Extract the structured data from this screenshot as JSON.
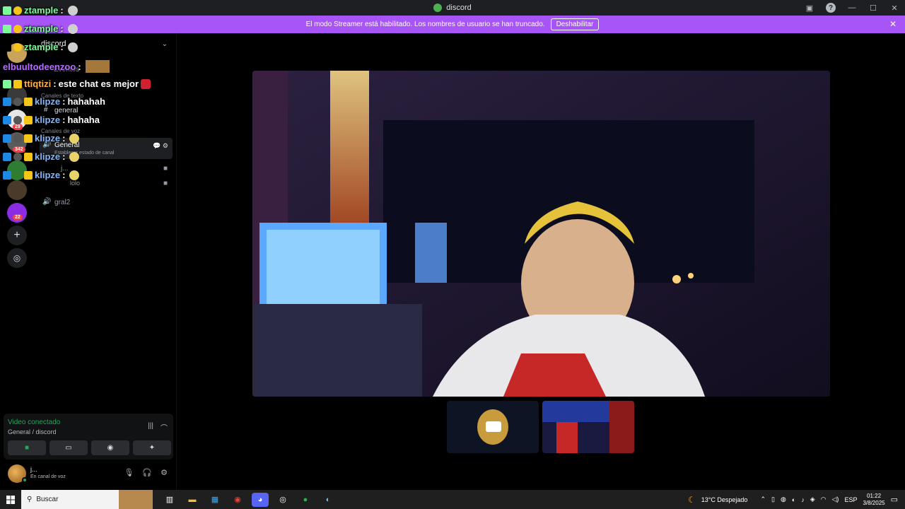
{
  "window": {
    "title": "discord",
    "help_icon": "?"
  },
  "banner": {
    "message": "El modo Streamer está habilitado. Los nombres de usuario se han truncado.",
    "button_label": "Deshabilitar"
  },
  "rail": {
    "badges": [
      "29",
      "342",
      "22"
    ]
  },
  "sidebar": {
    "server_name": "discord",
    "events_label": "Eventos",
    "text_category": "Canales de texto",
    "text_channel": "general",
    "voice_category": "Canales de voz",
    "voice_channel": "General",
    "channel_status_placeholder": "Establecer estado de canal",
    "voice_user_1": "j...",
    "voice_user_2": "lolo",
    "voice_channel_2": "gral2"
  },
  "voice_panel": {
    "status": "Video conectado",
    "location": "General / discord"
  },
  "user_panel": {
    "name": "j...",
    "status": "En canal de voz"
  },
  "chat": [
    {
      "user": "ztample",
      "message": "",
      "color": "#7CFC9A"
    },
    {
      "user": "ztample",
      "message": "",
      "color": "#7CFC9A"
    },
    {
      "user": "ztample",
      "message": "",
      "color": "#7CFC9A"
    },
    {
      "user": "elbuultodeenzoo",
      "message": "",
      "color": "#b46cff"
    },
    {
      "user": "ttiqtizi",
      "message": "este chat es mejor",
      "color": "#ffb14a"
    },
    {
      "user": "klipze",
      "message": "hahahah",
      "color": "#7fb6ff"
    },
    {
      "user": "klipze",
      "message": "hahaha",
      "color": "#7fb6ff"
    },
    {
      "user": "klipze",
      "message": "",
      "color": "#7fb6ff"
    },
    {
      "user": "klipze",
      "message": "",
      "color": "#7fb6ff"
    },
    {
      "user": "klipze",
      "message": "",
      "color": "#7fb6ff"
    }
  ],
  "taskbar": {
    "search_placeholder": "Buscar",
    "weather": "13°C  Despejado",
    "language": "ESP",
    "time": "01:22",
    "date": "3/8/2025"
  }
}
